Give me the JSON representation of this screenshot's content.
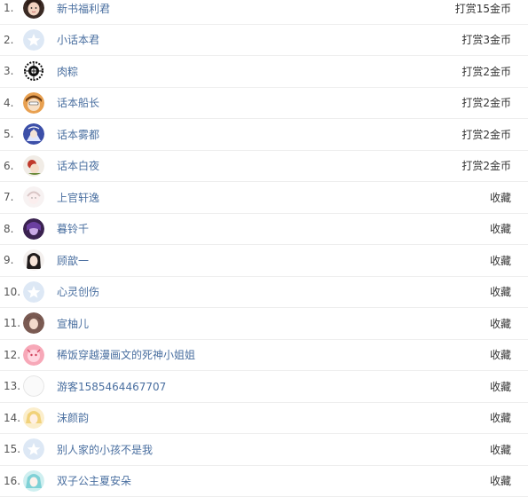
{
  "leaderboard": {
    "rows": [
      {
        "rank": "1.",
        "name": "新书福利君",
        "action": "打赏15金币",
        "avatar": "photo-girl-icon"
      },
      {
        "rank": "2.",
        "name": "小话本君",
        "action": "打赏3金币",
        "avatar": "default-star-avatar-icon"
      },
      {
        "rank": "3.",
        "name": "肉粽",
        "action": "打赏2金币",
        "avatar": "ornament-avatar-icon"
      },
      {
        "rank": "4.",
        "name": "话本船长",
        "action": "打赏2金币",
        "avatar": "anime-avatar-icon"
      },
      {
        "rank": "5.",
        "name": "话本雾都",
        "action": "打赏2金币",
        "avatar": "anime-avatar-icon"
      },
      {
        "rank": "6.",
        "name": "话本白夜",
        "action": "打赏2金币",
        "avatar": "anime-avatar-icon"
      },
      {
        "rank": "7.",
        "name": "上官轩逸",
        "action": "收藏",
        "avatar": "anime-avatar-icon"
      },
      {
        "rank": "8.",
        "name": "暮铃千",
        "action": "收藏",
        "avatar": "anime-avatar-icon"
      },
      {
        "rank": "9.",
        "name": "顾歆一",
        "action": "收藏",
        "avatar": "anime-avatar-icon"
      },
      {
        "rank": "10.",
        "name": "心灵创伤",
        "action": "收藏",
        "avatar": "default-star-avatar-icon"
      },
      {
        "rank": "11.",
        "name": "宣柚儿",
        "action": "收藏",
        "avatar": "anime-avatar-icon"
      },
      {
        "rank": "12.",
        "name": "稀饭穿越漫画文的死神小姐姐",
        "action": "收藏",
        "avatar": "anime-avatar-icon"
      },
      {
        "rank": "13.",
        "name": "游客1585464467707",
        "action": "收藏",
        "avatar": "blank-avatar-icon"
      },
      {
        "rank": "14.",
        "name": "沫颜韵",
        "action": "收藏",
        "avatar": "anime-avatar-icon"
      },
      {
        "rank": "15.",
        "name": "别人家的小孩不是我",
        "action": "收藏",
        "avatar": "default-star-avatar-icon"
      },
      {
        "rank": "16.",
        "name": "双子公主夏安朵",
        "action": "收藏",
        "avatar": "anime-avatar-icon"
      }
    ]
  },
  "colors": {
    "name_link": "#4a6fa0",
    "rank_text": "#555555",
    "action_text": "#333333",
    "divider": "#eeeeee",
    "default_avatar_bg": "#dde8f5"
  }
}
